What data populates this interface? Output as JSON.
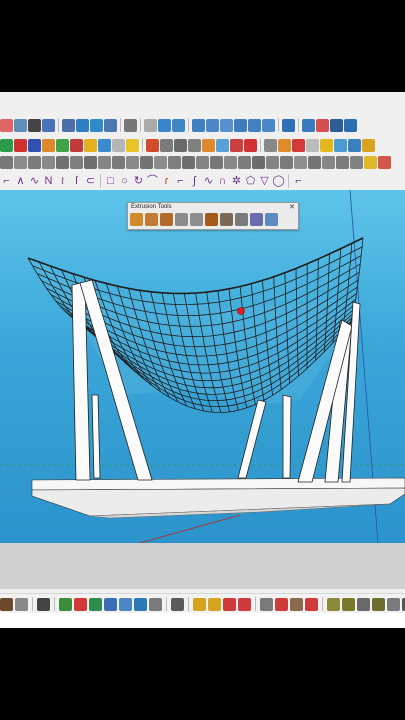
{
  "extrusion_tools": {
    "title": "Extrusion Tools",
    "tools": [
      {
        "icon": "ruled-surface-icon",
        "color": "#d08a2c"
      },
      {
        "icon": "skin-surface-icon",
        "color": "#c47a35"
      },
      {
        "icon": "loft-surface-icon",
        "color": "#b46a2a"
      },
      {
        "icon": "sweep-surface-icon",
        "color": "#8b8b8b"
      },
      {
        "icon": "tube-surface-icon",
        "color": "#8e8e8e"
      },
      {
        "icon": "extrude-edges-icon",
        "color": "#a55a1d"
      },
      {
        "icon": "edges-by-vector-icon",
        "color": "#7b6a55"
      },
      {
        "icon": "lathe-icon",
        "color": "#7a7a7a"
      },
      {
        "icon": "follow-rail-icon",
        "color": "#6b6bb0"
      },
      {
        "icon": "extrude-face-icon",
        "color": "#5b8bc0"
      }
    ]
  },
  "toolbars": {
    "row1": [
      {
        "icon": "sandbox-icon",
        "color": "#e06464"
      },
      {
        "icon": "tape-measure-icon",
        "color": "#5f8fb8"
      },
      {
        "icon": "zoom-icon",
        "color": "#444444"
      },
      {
        "icon": "orbit-icon",
        "color": "#4a72b8"
      },
      {
        "sep": true
      },
      {
        "icon": "walk-icon",
        "color": "#4a6fa8"
      },
      {
        "icon": "look-around-icon",
        "color": "#2e7fc2"
      },
      {
        "icon": "section-plane-icon",
        "color": "#2f8bc8"
      },
      {
        "icon": "pan-icon",
        "color": "#4b78b3"
      },
      {
        "sep": true
      },
      {
        "icon": "model-info-icon",
        "color": "#777777"
      },
      {
        "sep": true
      },
      {
        "icon": "new-file-icon",
        "color": "#aaaaaa"
      },
      {
        "icon": "open-file-icon",
        "color": "#3a85d0"
      },
      {
        "icon": "camera-icon",
        "color": "#3f86c7"
      },
      {
        "sep": true
      },
      {
        "icon": "iso-view-icon",
        "color": "#3f7fc4"
      },
      {
        "icon": "top-view-icon",
        "color": "#4a86c8"
      },
      {
        "icon": "front-view-icon",
        "color": "#5690ce"
      },
      {
        "icon": "right-view-icon",
        "color": "#3e7cc0"
      },
      {
        "icon": "back-view-icon",
        "color": "#4380c3"
      },
      {
        "icon": "left-view-icon",
        "color": "#4b87c9"
      },
      {
        "sep": true
      },
      {
        "icon": "component-icon",
        "color": "#2f6fb8"
      },
      {
        "sep": true
      },
      {
        "icon": "warehouse-icon",
        "color": "#3a7bbf"
      },
      {
        "icon": "extension-icon",
        "color": "#d45050"
      },
      {
        "icon": "select-icon",
        "color": "#2e5d96"
      },
      {
        "icon": "paint-icon",
        "color": "#2d6eb0"
      }
    ],
    "row2": [
      {
        "icon": "fredo-scale-icon",
        "color": "#2b9b4a"
      },
      {
        "icon": "weld-icon",
        "color": "#d03030"
      },
      {
        "icon": "joint-push-pull-icon",
        "color": "#3050b0"
      },
      {
        "icon": "curviloft-icon",
        "color": "#e0892a"
      },
      {
        "icon": "round-corner-icon",
        "color": "#3fa34a"
      },
      {
        "icon": "tools-on-surface-icon",
        "color": "#c23b3b"
      },
      {
        "icon": "shape-bender-icon",
        "color": "#e4b020"
      },
      {
        "icon": "flowify-icon",
        "color": "#3a8ad0"
      },
      {
        "icon": "vertex-tools-icon",
        "color": "#b6b6b6"
      },
      {
        "icon": "soap-bubble-icon",
        "color": "#e7c42a"
      },
      {
        "sep": true
      },
      {
        "icon": "pencil-icon",
        "color": "#d24b2d"
      },
      {
        "icon": "rectangle-icon",
        "color": "#7a7a7a"
      },
      {
        "icon": "circle-icon",
        "color": "#6a6a6a"
      },
      {
        "icon": "polygon-icon",
        "color": "#7f7f7f"
      },
      {
        "icon": "arc-icon",
        "color": "#e08a30"
      },
      {
        "icon": "pie-icon",
        "color": "#5aa0d8"
      },
      {
        "icon": "offset-icon",
        "color": "#cc3d3d"
      },
      {
        "icon": "rotate-icon",
        "color": "#d03232"
      },
      {
        "sep": true
      },
      {
        "icon": "follow-me-icon",
        "color": "#888888"
      },
      {
        "icon": "push-pull-icon",
        "color": "#e08a2a"
      },
      {
        "icon": "scale-icon",
        "color": "#d23a3a"
      },
      {
        "icon": "flip-icon",
        "color": "#bbbbbb"
      },
      {
        "icon": "intersect-icon",
        "color": "#e2b81f"
      },
      {
        "icon": "outer-shell-icon",
        "color": "#4a9bd4"
      },
      {
        "icon": "solid-union-icon",
        "color": "#3b7fc0"
      },
      {
        "icon": "split-icon",
        "color": "#d9a21f"
      }
    ],
    "row3": [
      {
        "icon": "dc-hammer-icon",
        "color": "#777777"
      },
      {
        "icon": "stair-icon",
        "color": "#8b8b8b"
      },
      {
        "icon": "window-icon",
        "color": "#7a7a7a"
      },
      {
        "icon": "door-icon",
        "color": "#898989"
      },
      {
        "icon": "roof-icon",
        "color": "#707070"
      },
      {
        "icon": "wall-icon",
        "color": "#7f7f7f"
      },
      {
        "icon": "column-icon",
        "color": "#6e6e6e"
      },
      {
        "icon": "beam-icon",
        "color": "#858585"
      },
      {
        "icon": "railing-icon",
        "color": "#7a7a7a"
      },
      {
        "icon": "frame-icon",
        "color": "#8a8a8a"
      },
      {
        "icon": "truss-icon",
        "color": "#737373"
      },
      {
        "icon": "grid-icon",
        "color": "#8c8c8c"
      },
      {
        "icon": "panel-icon",
        "color": "#7d7d7d"
      },
      {
        "icon": "mullion-icon",
        "color": "#6f6f6f"
      },
      {
        "icon": "lattice-icon",
        "color": "#838383"
      },
      {
        "icon": "cube-icon",
        "color": "#777777"
      },
      {
        "icon": "cylinder-icon",
        "color": "#888888"
      },
      {
        "icon": "cone-icon",
        "color": "#7c7c7c"
      },
      {
        "icon": "sphere-icon",
        "color": "#6d6d6d"
      },
      {
        "icon": "torus-icon",
        "color": "#848484"
      },
      {
        "icon": "pyramid-icon",
        "color": "#797979"
      },
      {
        "icon": "prism-icon",
        "color": "#8e8e8e"
      },
      {
        "icon": "helix-icon",
        "color": "#747474"
      },
      {
        "icon": "twist-icon",
        "color": "#868686"
      },
      {
        "icon": "bend-icon",
        "color": "#7b7b7b"
      },
      {
        "icon": "shell-icon",
        "color": "#818181"
      },
      {
        "icon": "lightbulb-icon",
        "color": "#e0b828"
      },
      {
        "icon": "color-palette-icon",
        "color": "#d2574a"
      }
    ],
    "row4": [
      {
        "icon": "line-tool-icon",
        "glyph": "⌐",
        "red": false
      },
      {
        "icon": "curve-tool-icon",
        "glyph": "∧",
        "red": false
      },
      {
        "icon": "freehand-icon",
        "glyph": "∿",
        "red": false
      },
      {
        "icon": "polyline-icon",
        "glyph": "N",
        "red": false
      },
      {
        "icon": "spline-icon",
        "glyph": "≀",
        "red": false
      },
      {
        "icon": "bezier-icon",
        "glyph": "ſ",
        "red": false
      },
      {
        "icon": "polygon-draw-icon",
        "glyph": "⊂",
        "red": false
      },
      {
        "sep": true
      },
      {
        "icon": "square-draw-icon",
        "glyph": "□",
        "red": false
      },
      {
        "icon": "circle-draw-icon",
        "glyph": "○",
        "red": false
      },
      {
        "icon": "spiral-icon",
        "glyph": "↻",
        "red": false
      },
      {
        "icon": "arc-draw-icon",
        "glyph": "⌒",
        "red": false
      },
      {
        "icon": "hook-icon",
        "glyph": "ɾ",
        "red": true
      },
      {
        "icon": "angle-icon",
        "glyph": "⌐",
        "red": false
      },
      {
        "icon": "sine-icon",
        "glyph": "ʃ",
        "red": false
      },
      {
        "icon": "wave-icon",
        "glyph": "∿",
        "red": false
      },
      {
        "icon": "parabola-icon",
        "glyph": "∩",
        "red": false
      },
      {
        "icon": "gear-draw-icon",
        "glyph": "✲",
        "red": false
      },
      {
        "icon": "pentagon-draw-icon",
        "glyph": "⬠",
        "red": false
      },
      {
        "icon": "triangle-draw-icon",
        "glyph": "▽",
        "red": false
      },
      {
        "icon": "ellipse-draw-icon",
        "glyph": "◯",
        "red": false
      },
      {
        "sep": true
      },
      {
        "icon": "text-tool-icon",
        "glyph": "⌐",
        "red": false
      }
    ],
    "bottom": [
      {
        "icon": "select-arrow-icon",
        "color": "#6a4a2a"
      },
      {
        "icon": "eraser-icon",
        "color": "#888888"
      },
      {
        "sep": true
      },
      {
        "icon": "arrow-left-right-icon",
        "color": "#444444"
      },
      {
        "sep": true
      },
      {
        "icon": "array-icon",
        "color": "#3b8e3b"
      },
      {
        "icon": "move-icon",
        "color": "#d23a3a"
      },
      {
        "icon": "copy-icon",
        "color": "#2f8d4b"
      },
      {
        "icon": "radial-array-icon",
        "color": "#3a6fb8"
      },
      {
        "icon": "flip-along-icon",
        "color": "#4a86c8"
      },
      {
        "icon": "drop-icon",
        "color": "#2a7ab8"
      },
      {
        "icon": "paint-bucket-icon",
        "color": "#7a7a7a"
      },
      {
        "sep": true
      },
      {
        "icon": "shield-icon",
        "color": "#5a5a5a"
      },
      {
        "sep": true
      },
      {
        "icon": "coin-icon",
        "color": "#d6a31f"
      },
      {
        "icon": "delete-coin-icon",
        "color": "#d6a31f"
      },
      {
        "icon": "block-icon",
        "color": "#cf3b3b"
      },
      {
        "icon": "ban-icon",
        "color": "#cf3b3b"
      },
      {
        "sep": true
      },
      {
        "icon": "bar-chart-icon",
        "color": "#7a7a7a"
      },
      {
        "icon": "stop-icon",
        "color": "#cf3b3b"
      },
      {
        "icon": "hand-icon",
        "color": "#8a6a4a"
      },
      {
        "icon": "no-entry-icon",
        "color": "#cf3b3b"
      },
      {
        "sep": true
      },
      {
        "icon": "circle-olive-icon",
        "color": "#8a8a3a"
      },
      {
        "icon": "triangle-olive-icon",
        "color": "#7a7a2a"
      },
      {
        "icon": "target-icon",
        "color": "#6a6a6a"
      },
      {
        "icon": "gear-bottom-icon",
        "color": "#6e6e2e"
      },
      {
        "icon": "image-icon",
        "color": "#7a7a7a"
      },
      {
        "icon": "resize-icon",
        "color": "#555555"
      }
    ]
  }
}
